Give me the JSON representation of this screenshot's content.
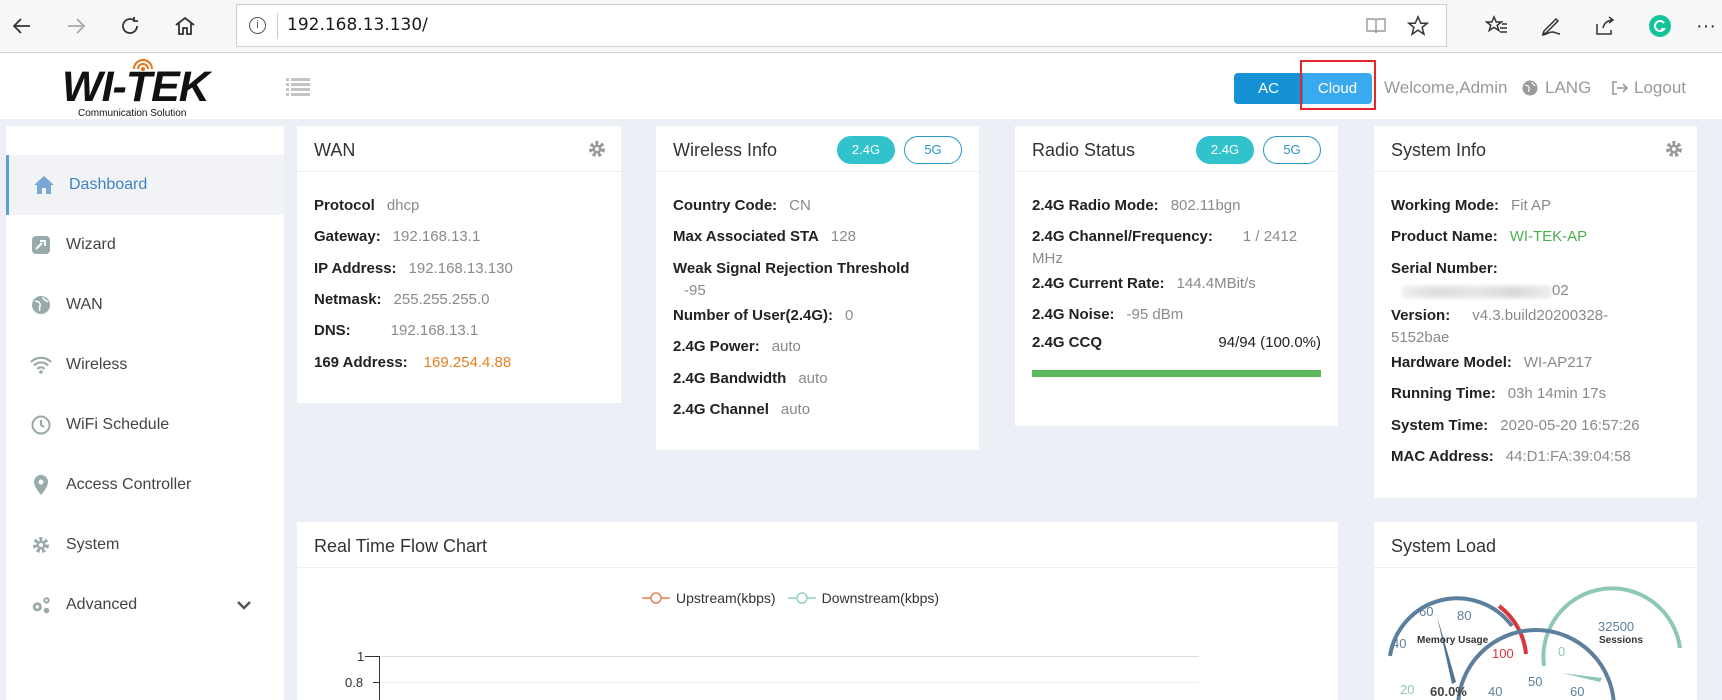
{
  "browser": {
    "url": "192.168.13.130/"
  },
  "header": {
    "logo_text": "WI-TEK",
    "logo_subtitle": "Communication Solution",
    "ac_label": "AC",
    "cloud_label": "Cloud",
    "welcome": "Welcome,Admin",
    "lang": "LANG",
    "logout": "Logout"
  },
  "sidebar": {
    "items": [
      {
        "label": "Dashboard",
        "icon": "home-icon",
        "active": true
      },
      {
        "label": "Wizard",
        "icon": "wizard-icon"
      },
      {
        "label": "WAN",
        "icon": "globe-icon"
      },
      {
        "label": "Wireless",
        "icon": "wifi-icon"
      },
      {
        "label": "WiFi Schedule",
        "icon": "clock-icon"
      },
      {
        "label": "Access Controller",
        "icon": "map-pin-icon"
      },
      {
        "label": "System",
        "icon": "gear-icon"
      },
      {
        "label": "Advanced",
        "icon": "gears-icon"
      }
    ]
  },
  "wan": {
    "title": "WAN",
    "rows": [
      {
        "label": "Protocol",
        "value": "dhcp"
      },
      {
        "label": "Gateway:",
        "value": "192.168.13.1"
      },
      {
        "label": "IP Address:",
        "value": "192.168.13.130"
      },
      {
        "label": "Netmask:",
        "value": "255.255.255.0"
      },
      {
        "label": "DNS:",
        "value": "192.168.13.1"
      },
      {
        "label": "169 Address:",
        "value": "169.254.4.88"
      }
    ]
  },
  "wireless": {
    "title": "Wireless Info",
    "tab_24": "2.4G",
    "tab_5": "5G",
    "rows": [
      {
        "label": "Country Code:",
        "value": "CN"
      },
      {
        "label": "Max Associated STA",
        "value": "128"
      },
      {
        "label": "Weak Signal Rejection Threshold",
        "value": "-95"
      },
      {
        "label": "Number of User(2.4G):",
        "value": "0"
      },
      {
        "label": "2.4G Power:",
        "value": "auto"
      },
      {
        "label": "2.4G Bandwidth",
        "value": "auto"
      },
      {
        "label": "2.4G Channel",
        "value": "auto"
      }
    ]
  },
  "radio": {
    "title": "Radio Status",
    "tab_24": "2.4G",
    "tab_5": "5G",
    "rows": [
      {
        "label": "2.4G Radio Mode:",
        "value": "802.11bgn"
      },
      {
        "label": "2.4G Channel/Frequency:",
        "value": "1 / 2412",
        "value2": "MHz"
      },
      {
        "label": "2.4G Current Rate:",
        "value": "144.4MBit/s"
      },
      {
        "label": "2.4G Noise:",
        "value": "-95 dBm"
      },
      {
        "label": "2.4G CCQ",
        "value": "94/94 (100.0%)"
      }
    ],
    "ccq_percent": 100
  },
  "system_info": {
    "title": "System Info",
    "rows": [
      {
        "label": "Working Mode:",
        "value": "Fit AP"
      },
      {
        "label": "Product Name:",
        "value": "WI-TEK-AP"
      },
      {
        "label": "Serial Number:",
        "value": "02"
      },
      {
        "label": "Version:",
        "value": "v4.3.build20200328-",
        "value2": "5152bae"
      },
      {
        "label": "Hardware Model:",
        "value": "WI-AP217"
      },
      {
        "label": "Running Time:",
        "value": "03h 14min 17s"
      },
      {
        "label": "System Time:",
        "value": "2020-05-20 16:57:26"
      },
      {
        "label": "MAC Address:",
        "value": "44:D1:FA:39:04:58"
      }
    ]
  },
  "flow_chart": {
    "title": "Real Time Flow Chart",
    "legend_up": "Upstream(kbps)",
    "legend_down": "Downstream(kbps)",
    "up_color": "#e67e52",
    "down_color": "#8fd3c1",
    "ticks": [
      "1",
      "0.8"
    ]
  },
  "system_load": {
    "title": "System Load",
    "memory_label": "Memory Usage",
    "memory_ticks": [
      "40",
      "60",
      "80",
      "100",
      "20"
    ],
    "memory_value": "60.0%",
    "sessions_label": "Sessions",
    "sessions_ticks": [
      "32500",
      "0"
    ],
    "third_ticks": [
      "40",
      "50",
      "60"
    ]
  },
  "colors": {
    "accent": "#1592d6",
    "orange_value": "#e67e22",
    "green_value": "#4cae4c",
    "ccq_bar": "#5cb85c",
    "pill_active": "#32c2cc"
  }
}
